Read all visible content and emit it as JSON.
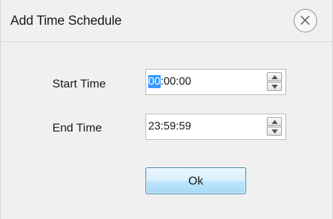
{
  "dialog": {
    "title": "Add Time Schedule",
    "close_icon": "close-circle-icon"
  },
  "start_time": {
    "label": "Start Time",
    "value_selected": "00",
    "value_rest": ":00:00",
    "spinner_up_icon": "arrow-up-icon",
    "spinner_down_icon": "arrow-down-icon"
  },
  "end_time": {
    "label": "End Time",
    "value": "23:59:59",
    "spinner_up_icon": "arrow-up-icon",
    "spinner_down_icon": "arrow-down-icon"
  },
  "buttons": {
    "ok_label": "Ok"
  },
  "colors": {
    "selection": "#3399ff",
    "button_border": "#3c7fb1"
  }
}
